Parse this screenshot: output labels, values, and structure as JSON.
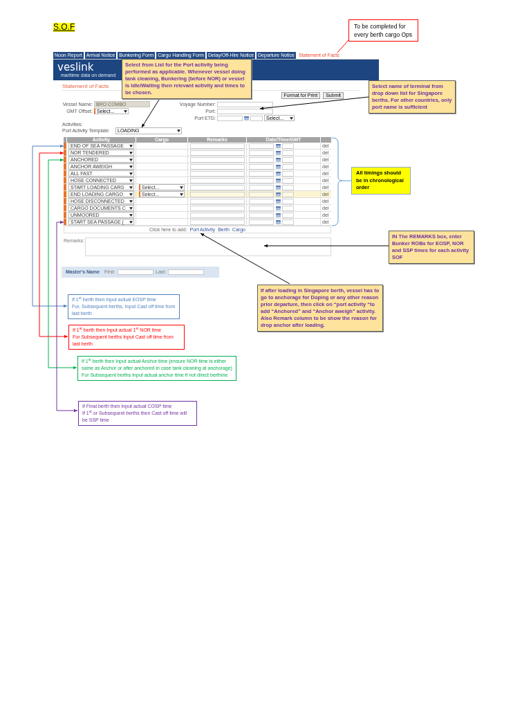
{
  "title": "S.O.F",
  "app": {
    "tabs": [
      {
        "label": "Noon Report",
        "selected": false
      },
      {
        "label": "Arrival Notice",
        "selected": false
      },
      {
        "label": "Bunkering Form",
        "selected": false
      },
      {
        "label": "Cargo Handling Form",
        "selected": false
      },
      {
        "label": "Delay/Off-Hire Notice",
        "selected": false
      },
      {
        "label": "Departure Notice",
        "selected": false
      },
      {
        "label": "Statement of Facts",
        "selected": true
      }
    ],
    "logo": "veslink",
    "tagline": "maritime data on demand",
    "heading": "Statement of Facts",
    "buttons": [
      "Format for Print",
      "Submit"
    ],
    "form": {
      "vessel_name": {
        "label": "Vessel Name:",
        "value": "BRO COMBO"
      },
      "gmt_offset": {
        "label": "GMT Offset:",
        "value": "Select..."
      },
      "voyage_number": {
        "label": "Voyage Number:"
      },
      "port": {
        "label": "Port:"
      },
      "port_etd": {
        "label": "Port ETD:",
        "select": "Select..."
      }
    },
    "activities_label": "Activities:",
    "template": {
      "label": "Port Activity Template:",
      "value": "LOADING"
    },
    "table": {
      "columns": [
        "Activity",
        "Cargo",
        "Remarks",
        "Date/Time/GMT"
      ],
      "rows": [
        {
          "activity": "END OF SEA PASSAGE",
          "delete": "del",
          "selected": false
        },
        {
          "activity": "NOR TENDERED",
          "delete": "del",
          "selected": false
        },
        {
          "activity": "ANCHORED",
          "delete": "del",
          "selected": false
        },
        {
          "activity": "ANCHOR AWEIGH",
          "delete": "del",
          "selected": false
        },
        {
          "activity": "ALL FAST",
          "delete": "del",
          "selected": false
        },
        {
          "activity": "HOSE CONNECTED",
          "delete": "del",
          "selected": false
        },
        {
          "activity": "START LOADING CARG",
          "cargo": "Select...",
          "delete": "del",
          "selected": false
        },
        {
          "activity": "END LOADING CARGO",
          "cargo": "Select...",
          "delete": "del",
          "selected": true
        },
        {
          "activity": "HOSE DISCONNECTED",
          "delete": "del",
          "selected": false
        },
        {
          "activity": "CARGO DOCUMENTS C",
          "delete": "del",
          "selected": false
        },
        {
          "activity": "UNMOORED",
          "delete": "del",
          "selected": false
        },
        {
          "activity": "START SEA PASSAGE (",
          "delete": "del",
          "selected": false
        }
      ]
    },
    "add_row": {
      "label": "Click here to add:",
      "links": [
        "Port Activity",
        "Berth",
        "Cargo"
      ]
    },
    "remarks": {
      "label": "Remarks:"
    },
    "master": {
      "label": "Master's Name",
      "first": "First:",
      "last": "Last:"
    }
  },
  "callouts": [
    {
      "kind": "outlined",
      "color": "#ff0000",
      "text": "To be completed for every berth cargo Ops"
    },
    {
      "kind": "note",
      "text": "Select from List for the Port activity being performed as applicable. Whenever vessel doing tank cleaning, Bunkering (before NOR) or vessel is Idle/Waiting then relevant activity and times to be chosen."
    },
    {
      "kind": "note",
      "text": "Select name of terminal from drop down list for Singapore berths. For other countries, only port name is sufficient"
    },
    {
      "kind": "highlight",
      "text": "All timings should be in chronological order"
    },
    {
      "kind": "note",
      "text": "IN The REMARKS box, enter Bunker ROBs for EOSP, NOR and SSP times for each activity SOF"
    },
    {
      "kind": "timing",
      "color": "#4f81bd",
      "lines": [
        "If 1$^{st}$ berth then Input actual EOSP time",
        "For, Subsequent berths, Input Cast off time from last berth"
      ]
    },
    {
      "kind": "timing",
      "color": "#ff0000",
      "lines": [
        "If 1$^{st}$ berth then Input actual 1$^{st}$ NOR time",
        "For Subsequent berths Input Cast off time from last berth"
      ]
    },
    {
      "kind": "note",
      "text": "If after loading in Singapore berth, vessel has to go to anchorage for Doping or any other reason prior departure, then click on “port activity “to add “Anchored” and “Anchor aweigh” activity. Also Remark column to be show the reason for drop anchor after loading."
    },
    {
      "kind": "timing",
      "color": "#00b050",
      "lines": [
        "If 1$^{st}$ berth then Input actual Anchor time (ensure NOR time is either same as Anchor or after anchored in case tank cleaning at anchorage)",
        "For Subsequent berths Input actual anchor time if not direct berthine"
      ]
    },
    {
      "kind": "timing",
      "color": "#7030a0",
      "lines": [
        "If Final berth then Input actual COSP time",
        "If 1$^{st}$ or Subsequent berths then Cast off time will be SSP time"
      ]
    }
  ]
}
